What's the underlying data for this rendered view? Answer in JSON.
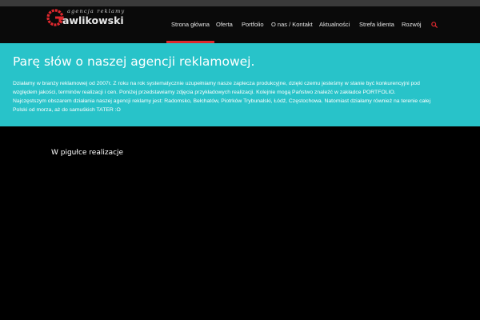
{
  "colors": {
    "accent": "#e0282e",
    "banner": "#28c3c9",
    "background": "#000000",
    "header": "#0a0a0a",
    "topbar": "#3a3a3a"
  },
  "logo": {
    "tagline": "agencja reklamy",
    "name": "awlikowski",
    "icon": "logo-g-icon"
  },
  "nav": {
    "items": [
      {
        "label": "Strona główna",
        "active": true
      },
      {
        "label": "Oferta"
      },
      {
        "label": "Portfolio"
      },
      {
        "label": "O nas / Kontakt"
      },
      {
        "label": "Aktualności"
      },
      {
        "label": "Strefa klienta"
      },
      {
        "label": "Rozwój"
      }
    ],
    "search_icon": "search-icon"
  },
  "banner": {
    "title": "Parę słów o naszej agencji reklamowej.",
    "lines": [
      "Działamy w branży reklamowej od 2007r. Z roku na rok systematycznie uzupełniamy nasze zaplecza produkcyjne, dzięki czemu jesteśmy w stanie być konkurencyjni pod",
      "względem jakości, terminów realizacji i cen. Poniżej przedstawiamy zdjęcia przykładowych realizacji. Kolejnie mogą Państwo znaleźć w zakładce PORTFOLIO.",
      "Najczęstszym obszarem działania naszej agencji reklamy jest: Radomsko, Bełchatów, Piotrków Trybunalski, Łódź, Częstochowa. Natomiast działamy również na terenie całej",
      "Polski od morza, aż do samuśkich TATER :O"
    ]
  },
  "section": {
    "title": "W pigułce realizacje"
  }
}
